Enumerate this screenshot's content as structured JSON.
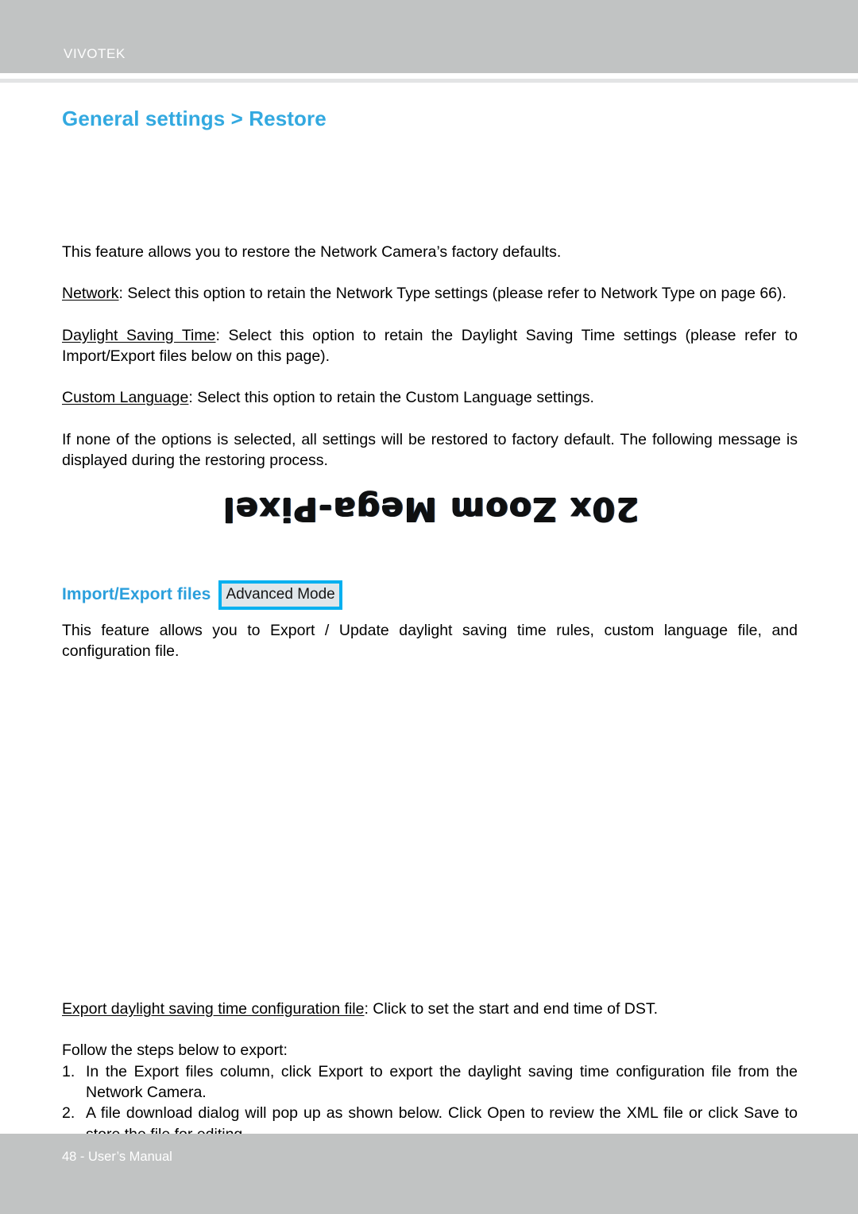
{
  "header": {
    "brand": "VIVOTEK",
    "band_color": "#c1c3c3",
    "rule_color": "#e3e4e5"
  },
  "page_title": "General settings > Restore",
  "title_color": "#33a9e0",
  "body": {
    "intro": "This feature allows you to restore the Network Camera’s factory defaults.",
    "network_label": "Network",
    "network_text": ": Select this option to retain the Network Type settings (please refer to Network Type on page 66).",
    "dst_label": "Daylight Saving Time",
    "dst_text": ": Select this option to retain the Daylight Saving Time settings (please refer to Import/Export files below on this page).",
    "custom_language_label": "Custom Language",
    "custom_language_text": ": Select this option to retain the Custom Language settings.",
    "none_selected": "If none of the options is selected, all settings will be restored to factory default.  The following message is displayed during the restoring process."
  },
  "banner": {
    "text": "20x Zoom Mega-Pixel",
    "rotation_degrees": 180
  },
  "section": {
    "heading": "Import/Export files",
    "badge_label": "Advanced Mode",
    "badge_border_color": "#00b0f0",
    "badge_fill_color": "#dfe6ea",
    "description": "This feature allows you to Export / Update daylight saving time rules, custom language file, and configuration file."
  },
  "export_block": {
    "export_label": "Export daylight saving time configuration file",
    "export_text": ": Click to set the start and end time of DST.",
    "follow_steps": "Follow the steps below to export:",
    "steps": [
      {
        "num": "1.",
        "text": "In the Export files column, click Export to export the daylight saving time configuration file from the Network Camera."
      },
      {
        "num": "2.",
        "text": "A file download dialog will pop up as shown below. Click Open to review the XML file or click Save to store the file for editing."
      }
    ]
  },
  "footer": {
    "text": "48 - User’s Manual",
    "band_color": "#c1c3c3"
  }
}
